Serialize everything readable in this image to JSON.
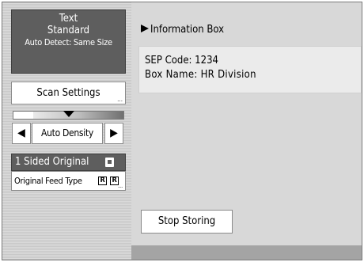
{
  "left_panel": {
    "mode": {
      "line1": "Text",
      "line2": "Standard",
      "line3": "Auto Detect: Same Size"
    },
    "scan_settings_label": "Scan Settings",
    "density": {
      "left_arrow": "◀",
      "right_arrow": "▶",
      "auto_label": "Auto Density",
      "level": 0.5
    },
    "sided_label": "1 Sided Original",
    "feed_label": "Original Feed Type",
    "feed_icon_1": "R",
    "feed_icon_2": "R",
    "more_dots": "..."
  },
  "right_panel": {
    "title": "Information Box",
    "sep_code": "SEP Code: 1234",
    "box_name": "Box Name: HR Division",
    "stop_label": "Stop Storing"
  },
  "icons": {
    "title_arrow": "triangle-right-icon",
    "density_marker": "triangle-down-icon",
    "sided_icon": "page-icon"
  },
  "colors": {
    "dark_panel": "#5e5e5e",
    "right_background": "#d8d8d8",
    "info_box": "#ebebeb"
  }
}
